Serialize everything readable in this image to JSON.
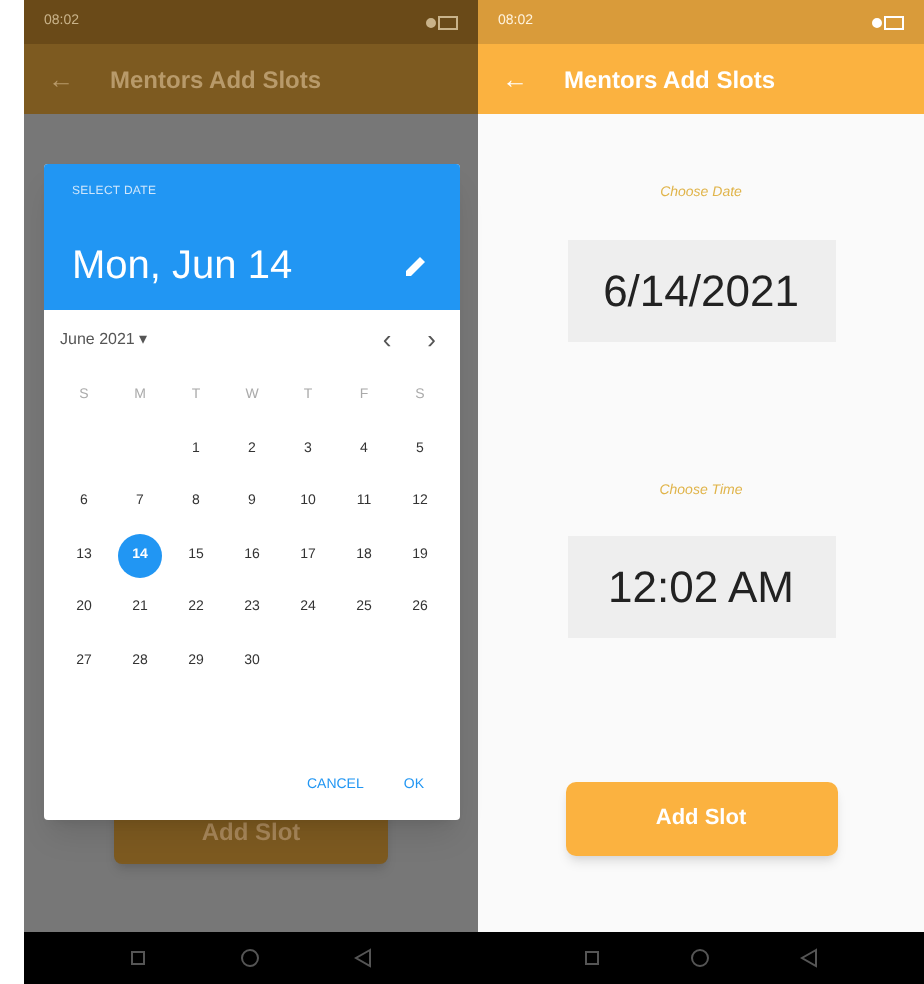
{
  "left_screen": {
    "status_bar": {
      "time": "08:02"
    },
    "app_bar": {
      "back": "←",
      "title": "Mentors Add Slots"
    },
    "add_slot_button": "Add Slot",
    "date_picker": {
      "header_label": "SELECT DATE",
      "selected_date": "Mon, Jun 14",
      "month_label": "June 2021",
      "month_caret": "▾",
      "prev": "‹",
      "next": "›",
      "weekdays": [
        "S",
        "M",
        "T",
        "W",
        "T",
        "F",
        "S"
      ],
      "weeks": [
        {
          "days": [
            {
              "label": "1",
              "selected": false
            },
            {
              "label": "2",
              "selected": false
            },
            {
              "label": "3",
              "selected": false
            },
            {
              "label": "4",
              "selected": false
            },
            {
              "label": "5",
              "selected": false
            }
          ]
        },
        {
          "days": [
            {
              "label": "6",
              "selected": false
            },
            {
              "label": "7",
              "selected": false
            },
            {
              "label": "8",
              "selected": false
            },
            {
              "label": "9",
              "selected": false
            },
            {
              "label": "10",
              "selected": false
            },
            {
              "label": "11",
              "selected": false
            },
            {
              "label": "12",
              "selected": false
            }
          ]
        },
        {
          "days": [
            {
              "label": "13",
              "selected": false
            },
            {
              "label": "14",
              "selected": true
            },
            {
              "label": "15",
              "selected": false
            },
            {
              "label": "16",
              "selected": false
            },
            {
              "label": "17",
              "selected": false
            },
            {
              "label": "18",
              "selected": false
            },
            {
              "label": "19",
              "selected": false
            }
          ]
        },
        {
          "days": [
            {
              "label": "20",
              "selected": false
            },
            {
              "label": "21",
              "selected": false
            },
            {
              "label": "22",
              "selected": false
            },
            {
              "label": "23",
              "selected": false
            },
            {
              "label": "24",
              "selected": false
            },
            {
              "label": "25",
              "selected": false
            },
            {
              "label": "26",
              "selected": false
            }
          ]
        },
        {
          "days": [
            {
              "label": "27",
              "selected": false
            },
            {
              "label": "28",
              "selected": false
            },
            {
              "label": "29",
              "selected": false
            },
            {
              "label": "30",
              "selected": false
            }
          ]
        }
      ],
      "buttons": [
        "CANCEL",
        "OK"
      ]
    }
  },
  "right_screen": {
    "status_bar": {
      "time": "08:02"
    },
    "app_bar": {
      "back": "←",
      "title": "Mentors Add Slots"
    },
    "fields": [
      {
        "label": "Choose Date",
        "value": "6/14/2021"
      },
      {
        "label": "Choose Time",
        "value": "12:02 AM"
      }
    ],
    "add_slot_button": "Add Slot"
  }
}
